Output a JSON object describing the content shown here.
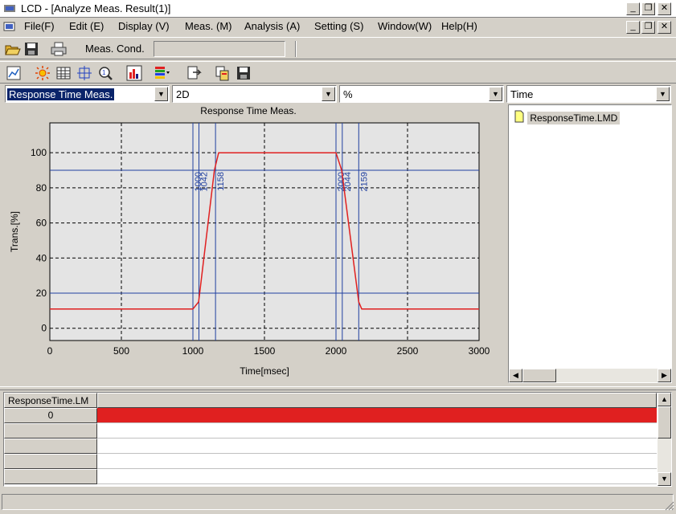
{
  "window": {
    "title": "LCD - [Analyze Meas. Result(1)]",
    "minimize_glyph": "_",
    "restore_glyph": "❐",
    "close_glyph": "✕"
  },
  "menu": {
    "items": [
      "File(F)",
      "Edit (E)",
      "Display (V)",
      "Meas. (M)",
      "Analysis (A)",
      "Setting (S)",
      "Window(W)",
      "Help(H)"
    ]
  },
  "toolbar1": {
    "meas_cond_label": "Meas. Cond.",
    "meas_cond_value": ""
  },
  "toolbar2": {
    "icons": [
      "graph-view-icon",
      "sun-icon",
      "table-icon",
      "crosshair-icon",
      "zoom-icon",
      "bar-chart-icon",
      "color-icon",
      "export-icon",
      "copy-icon",
      "save-icon"
    ]
  },
  "selectors": {
    "mode": "Response Time Meas.",
    "dimension": "2D",
    "unit": "%",
    "axis": "Time"
  },
  "chart_data": {
    "type": "line",
    "title": "Response Time Meas.",
    "xlabel": "Time[msec]",
    "ylabel": "Trans.[%]",
    "xlim": [
      0,
      3000
    ],
    "ylim": [
      -7,
      117
    ],
    "xticks": [
      "0",
      "500",
      "1000",
      "1500",
      "2000",
      "2500",
      "3000"
    ],
    "yticks": [
      "0",
      "20",
      "40",
      "60",
      "80",
      "100"
    ],
    "grid": true,
    "series": [
      {
        "color": "#e02020",
        "x": [
          0,
          1000,
          1040,
          1150,
          1180,
          2000,
          2040,
          2159,
          2180,
          3000
        ],
        "y": [
          11,
          11,
          15,
          90,
          100,
          100,
          90,
          15,
          11,
          11
        ]
      }
    ],
    "markers": [
      {
        "x": 1000,
        "label": "1000"
      },
      {
        "x": 1042,
        "label": "1042"
      },
      {
        "x": 1158,
        "label": "1158"
      },
      {
        "x": 2000,
        "label": "2000"
      },
      {
        "x": 2044,
        "label": "2044"
      },
      {
        "x": 2159,
        "label": "2159"
      }
    ],
    "threshold_lines": [
      20,
      90
    ],
    "marker_color": "#2040a0"
  },
  "tree": {
    "file": "ResponseTime.LMD"
  },
  "grid": {
    "header": "ResponseTime.LM",
    "rows": [
      "0",
      "",
      "",
      "",
      ""
    ],
    "first_row_color": "#e02020"
  }
}
